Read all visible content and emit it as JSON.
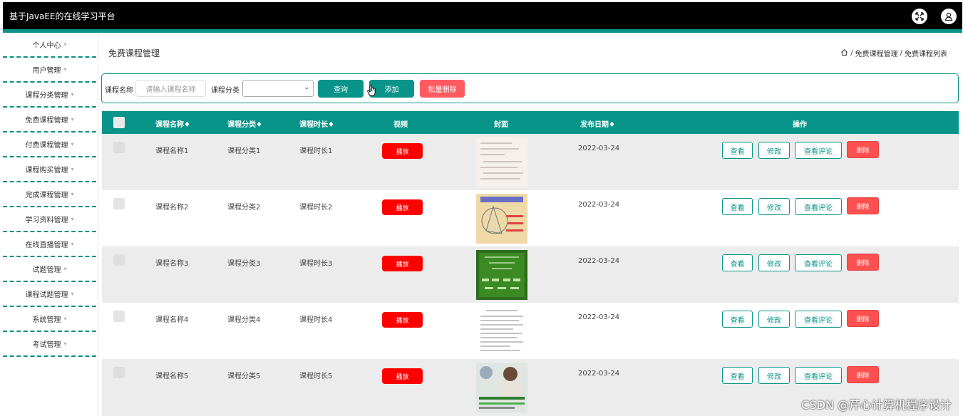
{
  "app": {
    "title": "基于JavaEE的在线学习平台"
  },
  "colors": {
    "accent": "#089489",
    "danger": "#ff5050",
    "play": "#ff0000"
  },
  "sidebar": {
    "items": [
      {
        "label": "个人中心"
      },
      {
        "label": "用户管理"
      },
      {
        "label": "课程分类管理"
      },
      {
        "label": "免费课程管理"
      },
      {
        "label": "付费课程管理"
      },
      {
        "label": "课程购买管理"
      },
      {
        "label": "完成课程管理"
      },
      {
        "label": "学习资料管理"
      },
      {
        "label": "在线直播管理"
      },
      {
        "label": "试题管理"
      },
      {
        "label": "课程试题管理"
      },
      {
        "label": "系统管理"
      },
      {
        "label": "考试管理"
      }
    ]
  },
  "page": {
    "title": "免费课程管理"
  },
  "breadcrumb": {
    "parent": "免费课程管理",
    "sep": "/",
    "current": "免费课程列表"
  },
  "search": {
    "name_label": "课程名称",
    "name_placeholder": "请输入课程名称",
    "category_label": "课程分类",
    "category_value": "",
    "query_button": "查询",
    "add_button": "添加",
    "batch_delete_button": "批量删除"
  },
  "table": {
    "headers": {
      "name": "课程名称♦",
      "category": "课程分类♦",
      "duration": "课程时长♦",
      "video": "视频",
      "cover": "封面",
      "date": "发布日期♦",
      "actions": "操作"
    },
    "play_label": "播放",
    "view_label": "查看",
    "edit_label": "修改",
    "comments_label": "查看评论",
    "delete_label": "删除",
    "rows": [
      {
        "name": "课程名称1",
        "category": "课程分类1",
        "duration": "课程时长1",
        "date": "2022-03-24"
      },
      {
        "name": "课程名称2",
        "category": "课程分类2",
        "duration": "课程时长2",
        "date": "2022-03-24"
      },
      {
        "name": "课程名称3",
        "category": "课程分类3",
        "duration": "课程时长3",
        "date": "2022-03-24"
      },
      {
        "name": "课程名称4",
        "category": "课程分类4",
        "duration": "课程时长4",
        "date": "2022-03-24"
      },
      {
        "name": "课程名称5",
        "category": "课程分类5",
        "duration": "课程时长5",
        "date": "2022-03-24"
      }
    ]
  },
  "watermark": "CSDN @芹心计算机程序设计"
}
